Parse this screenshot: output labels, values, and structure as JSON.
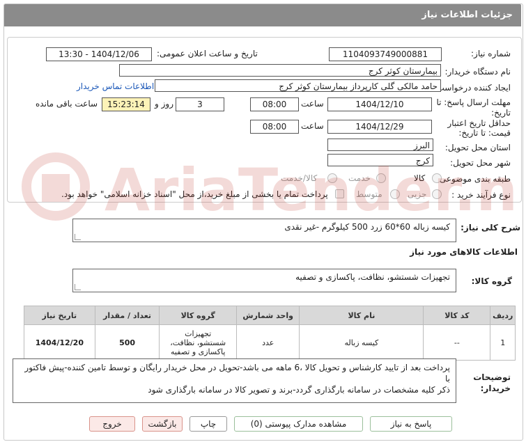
{
  "header": {
    "title": "جزئیات اطلاعات نیاز"
  },
  "fields": {
    "need_number_label": "شماره نیاز:",
    "need_number": "1104093749000881",
    "announce_label": "تاریخ و ساعت اعلان عمومی:",
    "announce_value": "1404/12/06 - 13:30",
    "buyer_org_label": "نام دستگاه خریدار:",
    "buyer_org": "بیمارستان کوثر کرج",
    "creator_label": "ایجاد کننده درخواست:",
    "creator": "حامد مالکی گلی کارپرداز بیمارستان کوثر کرج",
    "contact_link": "اطلاعات تماس خریدار",
    "deadline_label_1": "مهلت ارسال پاسخ: تا",
    "deadline_label_2": "تاریخ:",
    "deadline_date": "1404/12/10",
    "time_label": "ساعت",
    "deadline_time": "08:00",
    "days_value": "3",
    "days_label": "روز و",
    "remaining_time": "15:23:14",
    "remaining_label": "ساعت باقی مانده",
    "validity_label_1": "حداقل تاریخ اعتبار",
    "validity_label_2": "قیمت: تا تاریخ:",
    "validity_date": "1404/12/29",
    "validity_time": "08:00",
    "province_label": "استان محل تحویل:",
    "province": "البرز",
    "city_label": "شهر محل تحویل:",
    "city": "کرج",
    "category_label": "طبقه بندی موضوعی:",
    "category_options": [
      "کالا",
      "خدمت",
      "کالا/خدمت"
    ],
    "purchase_type_label": "نوع فرآیند خرید :",
    "purchase_options": [
      "جزیی",
      "متوسط"
    ],
    "treasury_note": "پرداخت تمام یا بخشی از مبلغ خرید،از محل \"اسناد خزانه اسلامی\" خواهد بود."
  },
  "summary": {
    "label": "شرح کلی نیاز:",
    "value": "کیسه زباله 60*60 زرد     500 کیلوگرم -غیر نقدی"
  },
  "goods_section_title": "اطلاعات کالاهای مورد نیاز",
  "goods_group": {
    "label": "گروه کالا:",
    "value": "تجهیزات شستشو، نظافت، پاکسازی و تصفیه"
  },
  "table": {
    "headers": [
      "ردیف",
      "کد کالا",
      "نام کالا",
      "واحد شمارش",
      "گروه کالا",
      "تعداد / مقدار",
      "تاریخ نیاز"
    ],
    "rows": [
      {
        "index": "1",
        "code": "--",
        "name": "کیسه زباله",
        "unit": "عدد",
        "group_line1": "تجهیزات",
        "group_line2": "شستشو، نظافت،",
        "group_line3": "پاکسازی و تصفیه",
        "quantity": "500",
        "date": "1404/12/20"
      }
    ]
  },
  "buyer_notes": {
    "label_1": "توضیحات",
    "label_2": "خریدار:",
    "line1": "پرداخت بعد از تایید کارشناس و تحویل کالا ،6 ماهه می باشد-تحویل در محل خریدار رایگان و توسط تامین کننده-پیش فاکتور با",
    "line2": "ذکر کلیه مشخصات در سامانه بارگذاری گردد-برند و تصویر کالا در سامانه بارگذاری شود"
  },
  "buttons": {
    "reply": "پاسخ به نیاز",
    "attachments": "مشاهده مدارک پیوستی (0)",
    "print": "چاپ",
    "back": "بازگشت",
    "exit": "خروج"
  },
  "watermark": {
    "text": "AriaTender.neT"
  },
  "colors": {
    "header_bg": "#8b8b8b",
    "highlight": "#fdf3b8",
    "link": "#1a57b8"
  }
}
